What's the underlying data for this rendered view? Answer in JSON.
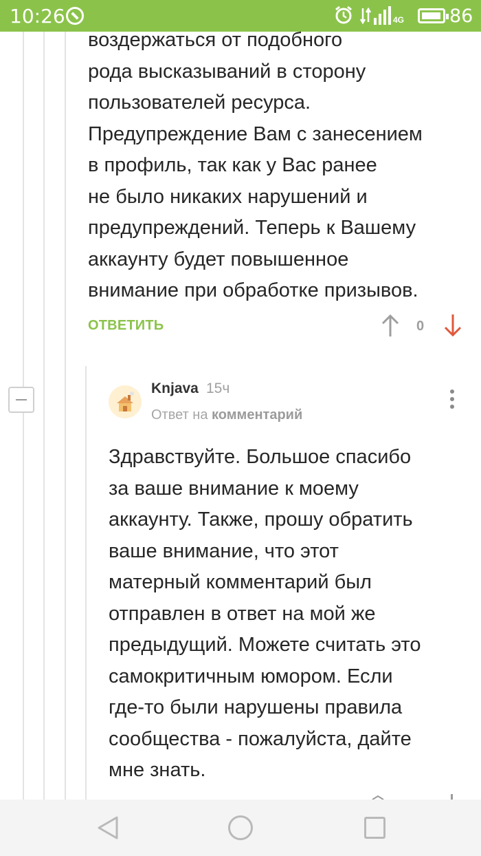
{
  "status_bar": {
    "time": "10:26",
    "network": "4G",
    "battery": "86",
    "icons": [
      "do-not-disturb-icon",
      "alarm-icon",
      "signal-icon",
      "battery-icon"
    ]
  },
  "parent_comment": {
    "text": "воздержаться от подобного\nрода высказываний в сторону\nпользователей ресурса.\nПредупреждение Вам с занесением\nв профиль, так как у Вас ранее\nне было никаких нарушений и\nпредупреждений. Теперь к Вашему\nаккаунту будет повышенное\nвнимание при обработке призывов.",
    "reply_label": "ОТВЕТИТЬ",
    "rating": "0"
  },
  "reply": {
    "author": "Knjava",
    "time": "15ч",
    "reply_prefix": "Ответ на",
    "reply_target": "комментарий",
    "text": "Здравствуйте. Большое спасибо\nза ваше внимание к моему\nаккаунту. Также, прошу обратить\nваше внимание, что этот\nматерный комментарий был\nотправлен в ответ на мой же\nпредыдущий. Можете считать это\nсамокритичным юмором. Если\nгде-то были нарушены правила\nсообщества - пожалуйста, дайте\nмне знать."
  },
  "colors": {
    "accent": "#8bc34a",
    "downvote": "#e0583c",
    "upvote": "#9e9e9e"
  },
  "nav_bar": {
    "icons": [
      "back-icon",
      "home-icon",
      "recent-apps-icon"
    ]
  }
}
